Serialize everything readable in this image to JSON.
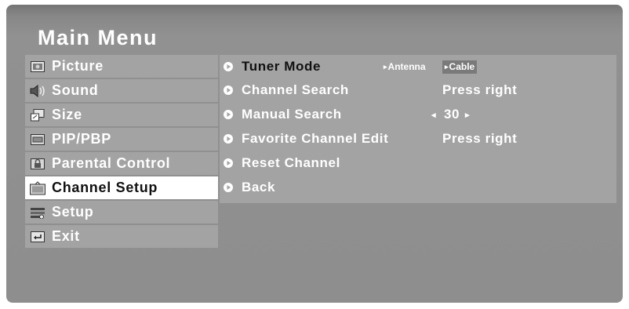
{
  "title": "Main Menu",
  "menu": {
    "items": [
      {
        "label": "Picture",
        "icon": "picture-icon"
      },
      {
        "label": "Sound",
        "icon": "speaker-icon"
      },
      {
        "label": "Size",
        "icon": "size-icon"
      },
      {
        "label": "PIP/PBP",
        "icon": "pip-icon"
      },
      {
        "label": "Parental  Control",
        "icon": "lock-icon"
      },
      {
        "label": "Channel  Setup",
        "icon": "tv-icon",
        "selected": true
      },
      {
        "label": "Setup",
        "icon": "setup-icon"
      },
      {
        "label": "Exit",
        "icon": "exit-icon"
      }
    ]
  },
  "channel_setup": {
    "tuner_mode": {
      "label": "Tuner  Mode",
      "options": [
        "Antenna",
        "Cable"
      ],
      "selected": "Cable"
    },
    "channel_search": {
      "label": "Channel  Search",
      "value": "Press  right"
    },
    "manual_search": {
      "label": "Manual Search",
      "value": "30",
      "left_arrow": "◂",
      "right_arrow": "▸"
    },
    "favorite_channel": {
      "label": "Favorite  Channel  Edit",
      "value": "Press  right"
    },
    "reset_channel": {
      "label": "Reset Channel"
    },
    "back": {
      "label": "Back"
    }
  },
  "colors": {
    "frame": "#8e8e8e",
    "item_bg": "#a3a3a3",
    "selected_bg": "#ffffff",
    "text": "#ffffff"
  }
}
